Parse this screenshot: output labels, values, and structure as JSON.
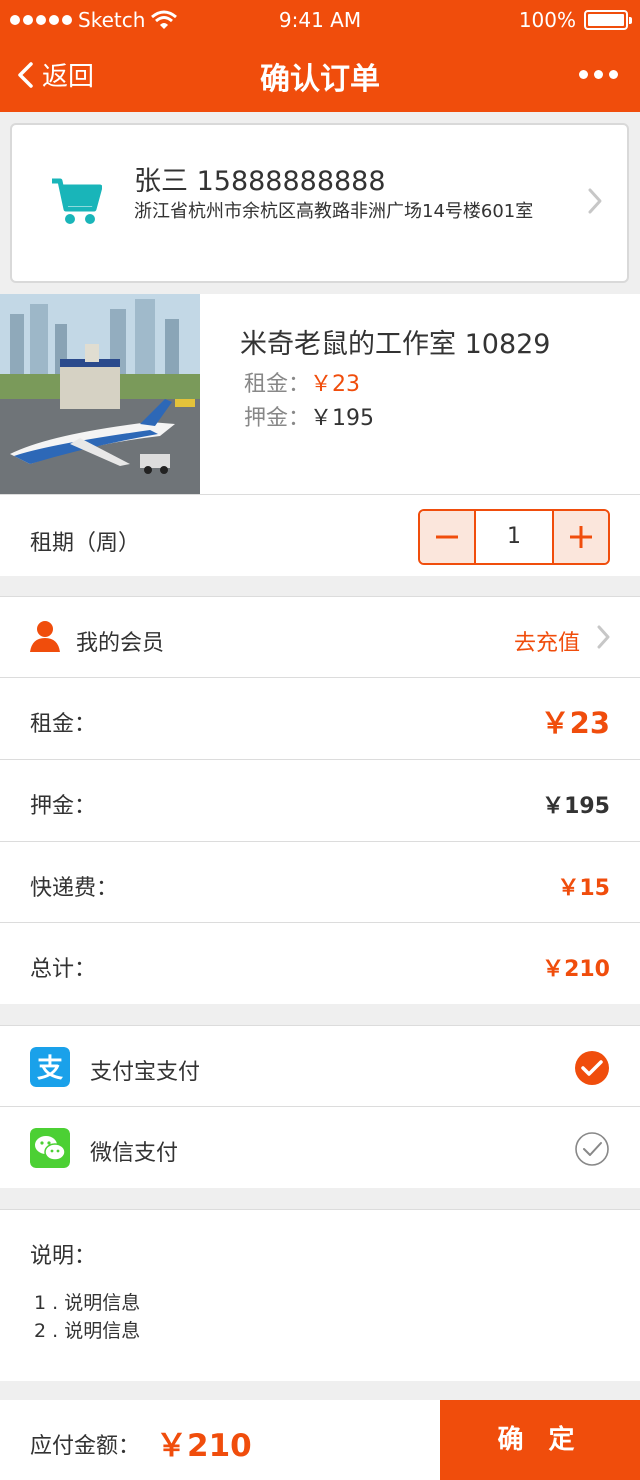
{
  "status_bar": {
    "carrier": "Sketch",
    "time": "9:41 AM",
    "battery": "100%"
  },
  "nav": {
    "back_label": "返回",
    "title": "确认订单"
  },
  "address": {
    "name_phone": "张三 15888888888",
    "detail": "浙江省杭州市余杭区高教路非洲广场14号楼601室"
  },
  "product": {
    "title": "米奇老鼠的工作室 10829",
    "rent_label": "租金：",
    "rent_value": "￥23",
    "deposit_label": "押金：",
    "deposit_value": "￥195"
  },
  "lease": {
    "label": "租期（周）",
    "quantity": "1"
  },
  "membership": {
    "label": "我的会员",
    "action": "去充值"
  },
  "summary": {
    "rent_label": "租金：",
    "rent_value": "￥23",
    "deposit_label": "押金：",
    "deposit_value": "￥195",
    "shipping_label": "快递费：",
    "shipping_value": "￥15",
    "total_label": "总计：",
    "total_value": "￥210"
  },
  "payment": {
    "alipay_label": "支付宝支付",
    "alipay_selected": true,
    "wechat_label": "微信支付",
    "wechat_selected": false
  },
  "notes": {
    "heading": "说明：",
    "items": [
      "1 . 说明信息",
      "2 . 说明信息"
    ]
  },
  "footer": {
    "amount_label": "应付金额：",
    "amount_value": "￥210",
    "confirm_label": "确 定"
  },
  "colors": {
    "accent": "#f04d0c",
    "teal": "#19b5b9",
    "alipay": "#1aa1ea",
    "wechat": "#4cd034"
  }
}
